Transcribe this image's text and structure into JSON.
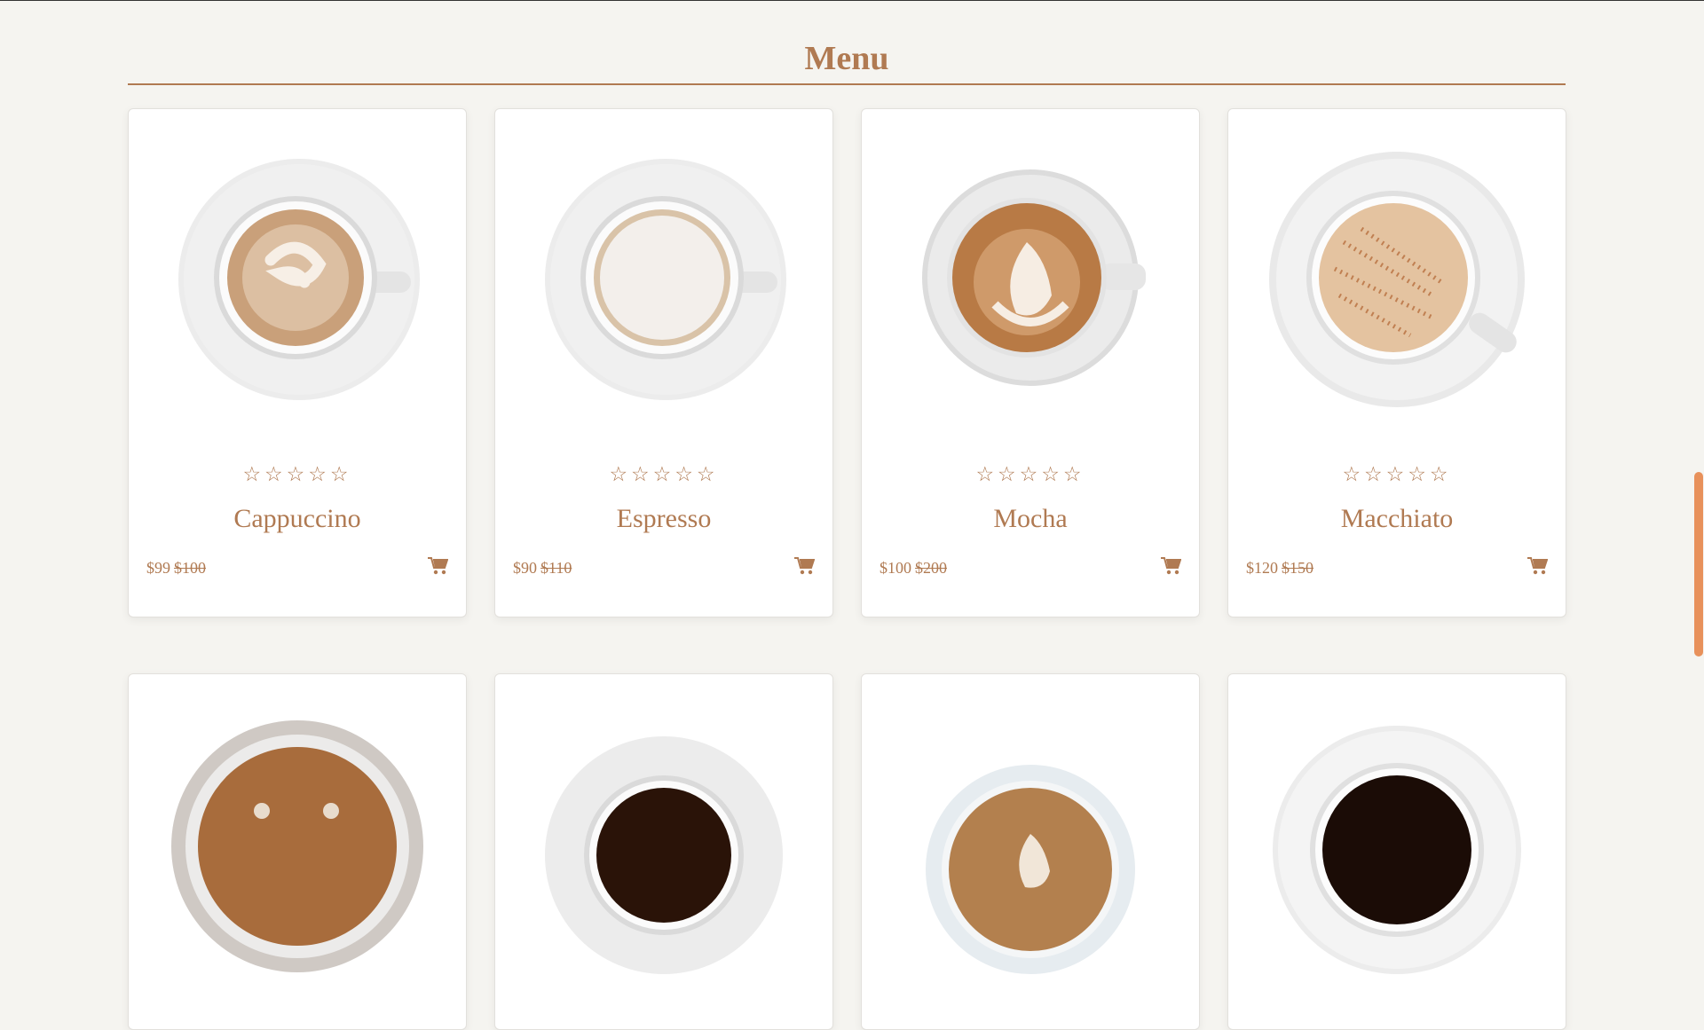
{
  "section": {
    "title": "Menu"
  },
  "products": [
    {
      "name": "Cappuccino",
      "price": "$99",
      "old_price": "$100",
      "rating": 0
    },
    {
      "name": "Espresso",
      "price": "$90",
      "old_price": "$110",
      "rating": 0
    },
    {
      "name": "Mocha",
      "price": "$100",
      "old_price": "$200",
      "rating": 0
    },
    {
      "name": "Macchiato",
      "price": "$120",
      "old_price": "$150",
      "rating": 0
    }
  ],
  "stars": "☆☆☆☆☆",
  "icons": {
    "cart": "cart-icon",
    "star": "star-outline-icon"
  },
  "colors": {
    "accent": "#b07a52",
    "background": "#f5f4f0",
    "scroll_thumb": "#e8915b"
  }
}
